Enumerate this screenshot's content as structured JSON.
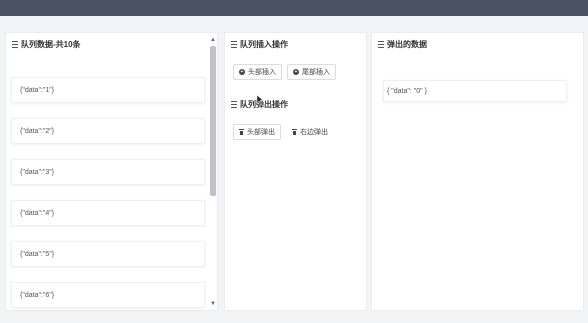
{
  "queue_panel": {
    "title": "队列数据-共10条",
    "items": [
      "{\"data\":\"1\"}",
      "{\"data\":\"2\"}",
      "{\"data\":\"3\"}",
      "{\"data\":\"4\"}",
      "{\"data\":\"5\"}",
      "{\"data\":\"6\"}"
    ]
  },
  "insert_panel": {
    "title": "队列插入操作",
    "buttons": [
      "头部插入",
      "尾部插入"
    ]
  },
  "pop_panel": {
    "title": "队列弹出操作",
    "buttons": [
      "头部弹出",
      "右边弹出"
    ]
  },
  "popped_panel": {
    "title": "弹出的数据",
    "value": "{ \"data\": \"0\" }"
  }
}
